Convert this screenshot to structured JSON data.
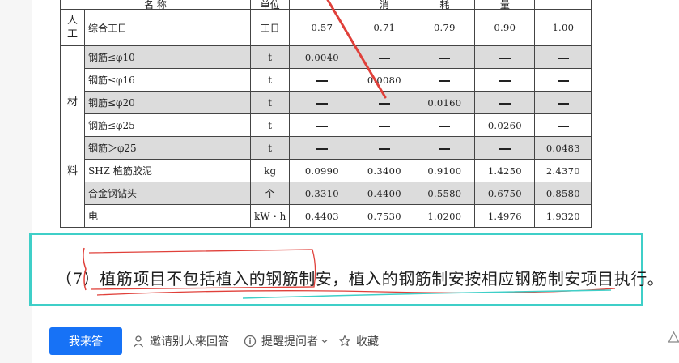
{
  "table": {
    "header": {
      "name": "名   称",
      "unit": "单位",
      "consumption_chars": [
        "消",
        "耗",
        "量"
      ]
    },
    "rows": [
      {
        "category": "人工",
        "name": "综合工日",
        "unit": "工日",
        "values": [
          "0.57",
          "0.71",
          "0.79",
          "0.90",
          "1.00"
        ]
      },
      {
        "category": "材料",
        "name": "钢筋≤φ10",
        "unit": "t",
        "values": [
          "0.0040",
          "—",
          "—",
          "—",
          "—"
        ]
      },
      {
        "name": "钢筋≤φ16",
        "unit": "t",
        "values": [
          "—",
          "0.0080",
          "—",
          "—",
          "—"
        ]
      },
      {
        "name": "钢筋≤φ20",
        "unit": "t",
        "values": [
          "—",
          "—",
          "0.0160",
          "—",
          "—"
        ]
      },
      {
        "name": "钢筋≤φ25",
        "unit": "t",
        "values": [
          "—",
          "—",
          "—",
          "0.0260",
          "—"
        ]
      },
      {
        "name": "钢筋＞φ25",
        "unit": "t",
        "values": [
          "—",
          "—",
          "—",
          "—",
          "0.0483"
        ]
      },
      {
        "name": "SHZ 植筋胶泥",
        "unit": "kg",
        "values": [
          "0.0990",
          "0.3400",
          "0.9100",
          "1.4250",
          "2.4370"
        ]
      },
      {
        "name": "合金钢钻头",
        "unit": "个",
        "values": [
          "0.3310",
          "0.4400",
          "0.5580",
          "0.6750",
          "0.8580"
        ]
      },
      {
        "name": "电",
        "unit": "kW・h",
        "values": [
          "0.4403",
          "0.7530",
          "1.0200",
          "1.4976",
          "1.9320"
        ]
      }
    ]
  },
  "note": {
    "prefix": "（7）",
    "text": "植筋项目不包括植入的钢筋制安，植入的钢筋制安按相应钢筋制安项目执行。"
  },
  "actions": {
    "answer": "我来答",
    "invite": "邀请别人来回答",
    "remind": "提醒提问者",
    "collect": "收藏"
  },
  "colors": {
    "highlight_box": "#3fcfc8",
    "annotation_red": "#e0403a",
    "primary_button": "#1772f6",
    "gray_row": "#dcdcdc"
  }
}
